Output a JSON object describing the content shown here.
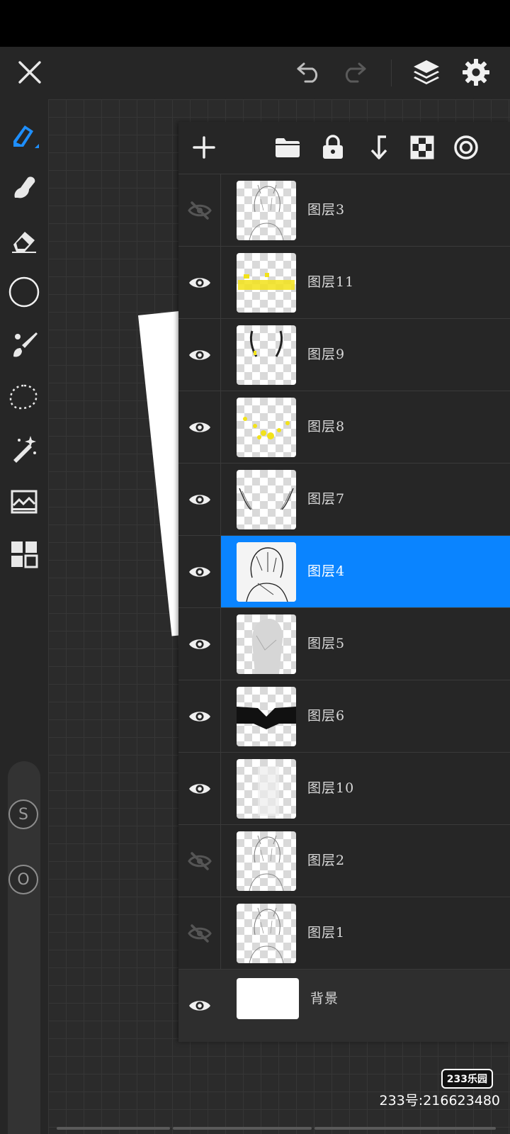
{
  "app": {
    "topbar": {
      "close_icon": "close-icon",
      "undo_icon": "undo-icon",
      "redo_icon": "redo-icon",
      "layers_icon": "layers-icon",
      "settings_icon": "gear-icon"
    },
    "tools": [
      {
        "name": "pencil",
        "active": true
      },
      {
        "name": "smudge",
        "active": false
      },
      {
        "name": "eraser",
        "active": false
      },
      {
        "name": "color",
        "active": false
      },
      {
        "name": "brush",
        "active": false
      },
      {
        "name": "lasso",
        "active": false
      },
      {
        "name": "magic-wand",
        "active": false
      },
      {
        "name": "adjust",
        "active": false
      },
      {
        "name": "grid",
        "active": false
      }
    ],
    "slider_labels": {
      "size": "S",
      "opacity": "O"
    }
  },
  "layers_panel": {
    "header_icons": [
      "add-icon",
      "folder-icon",
      "lock-icon",
      "merge-down-icon",
      "transparency-icon",
      "target-icon"
    ],
    "layers": [
      {
        "name": "图层3",
        "visible": false,
        "selected": false,
        "thumb": "sketch"
      },
      {
        "name": "图层11",
        "visible": true,
        "selected": false,
        "thumb": "yellow-band"
      },
      {
        "name": "图层9",
        "visible": true,
        "selected": false,
        "thumb": "horns"
      },
      {
        "name": "图层8",
        "visible": true,
        "selected": false,
        "thumb": "yellow-dots"
      },
      {
        "name": "图层7",
        "visible": true,
        "selected": false,
        "thumb": "wings"
      },
      {
        "name": "图层4",
        "visible": true,
        "selected": true,
        "thumb": "lineart"
      },
      {
        "name": "图层5",
        "visible": true,
        "selected": false,
        "thumb": "gray-figure"
      },
      {
        "name": "图层6",
        "visible": true,
        "selected": false,
        "thumb": "black-shape"
      },
      {
        "name": "图层10",
        "visible": true,
        "selected": false,
        "thumb": "faint"
      },
      {
        "name": "图层2",
        "visible": false,
        "selected": false,
        "thumb": "sketch"
      },
      {
        "name": "图层1",
        "visible": false,
        "selected": false,
        "thumb": "sketch"
      }
    ],
    "background": {
      "name": "背景",
      "visible": true
    }
  },
  "colors": {
    "accent": "#0a84ff",
    "panel": "#262626",
    "yellow": "#f2e21a"
  },
  "watermark": {
    "logo": "233乐园",
    "id_text": "233号:216623480"
  }
}
